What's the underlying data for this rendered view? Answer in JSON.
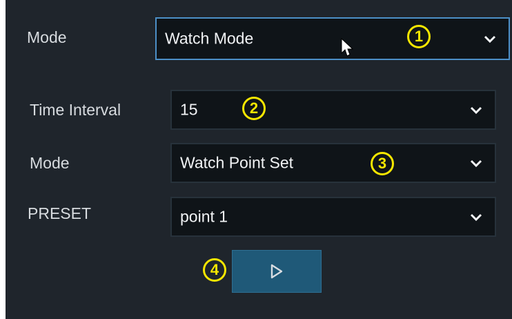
{
  "mode_row": {
    "label": "Mode",
    "value": "Watch Mode",
    "badge": "1"
  },
  "time_interval_row": {
    "label": "Time Interval",
    "value": "15",
    "badge": "2"
  },
  "mode2_row": {
    "label": "Mode",
    "value": "Watch Point Set",
    "badge": "3"
  },
  "preset_row": {
    "label": "PRESET",
    "value": "point 1"
  },
  "play_button": {
    "badge": "4"
  },
  "colors": {
    "panel": "#1f252c",
    "select_bg": "#0f1418",
    "active_border": "#4c8fc7",
    "play_button": "#1f5978",
    "badge": "#f6e600"
  },
  "icons": {
    "dropdown": "chevron-down-icon",
    "cursor": "mouse-pointer-icon",
    "play": "play-icon"
  }
}
